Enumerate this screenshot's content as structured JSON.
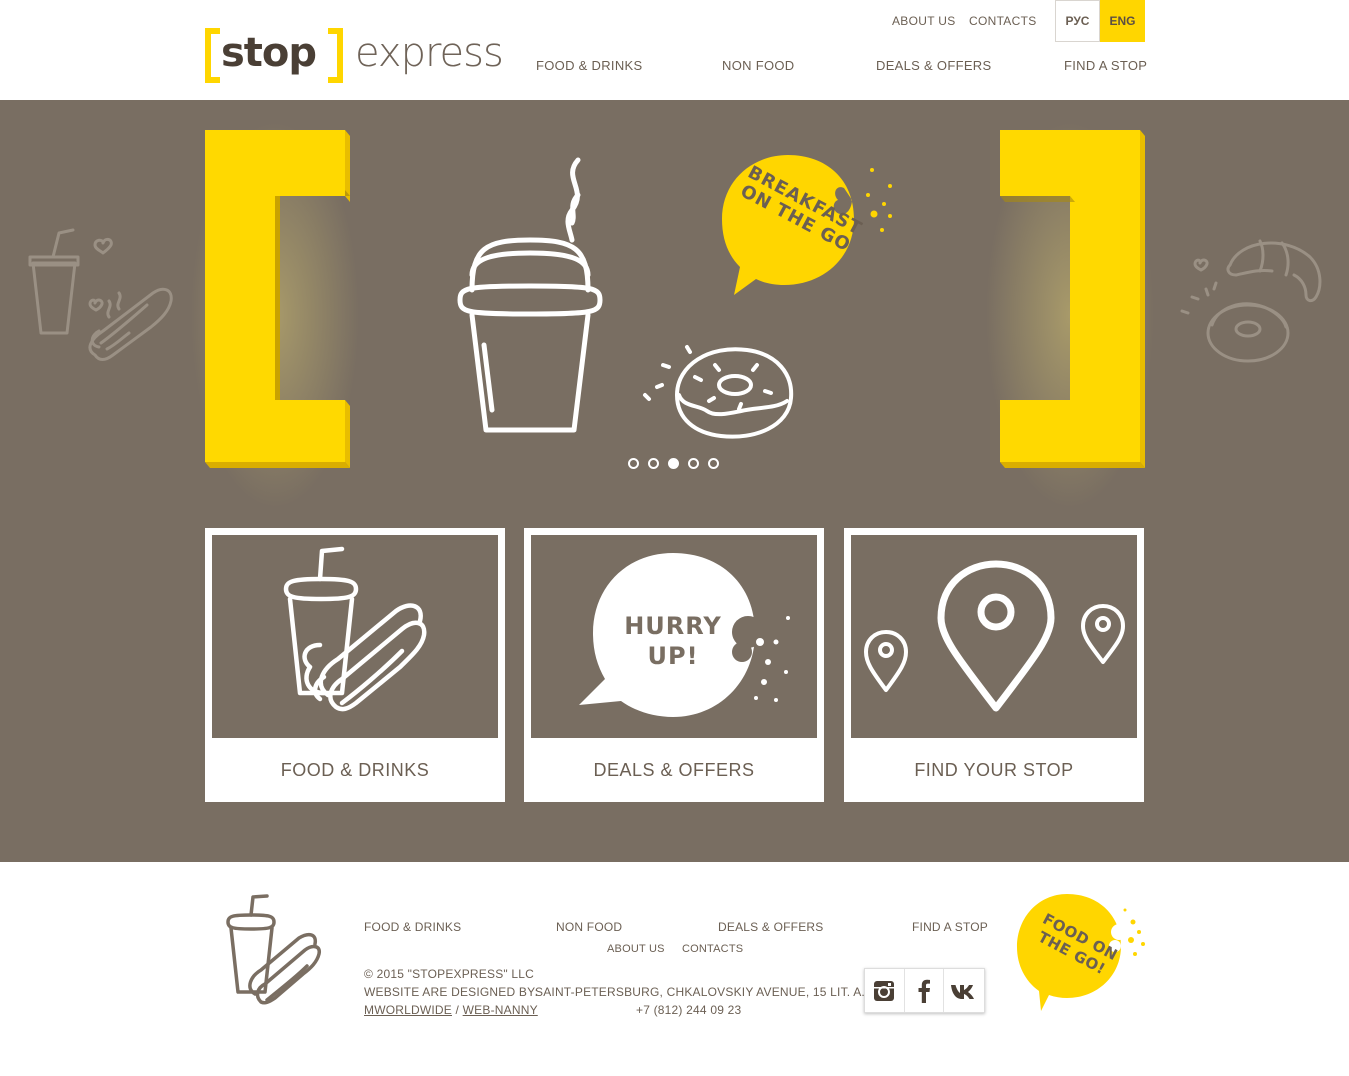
{
  "brand": {
    "stop": "stop",
    "express": "express",
    "yellow": "#ffd600",
    "brown": "#796e62"
  },
  "top_links": [
    "ABOUT US",
    "CONTACTS"
  ],
  "lang": {
    "ru": "РУС",
    "en": "ENG",
    "active": "ENG"
  },
  "nav": [
    "FOOD & DRINKS",
    "NON FOOD",
    "DEALS & OFFERS",
    "FIND A STOP"
  ],
  "hero": {
    "bubble_line1": "BREAKFAST",
    "bubble_line2": "ON THE GO",
    "slides_total": 5,
    "slide_active": 3
  },
  "cards": [
    {
      "label": "FOOD & DRINKS",
      "icon": "drink-hotdog-icon"
    },
    {
      "label": "DEALS & OFFERS",
      "icon": "hurry-up-bubble-icon",
      "bubble_line1": "HURRY",
      "bubble_line2": "UP!"
    },
    {
      "label": "FIND YOUR STOP",
      "icon": "map-pin-icon"
    }
  ],
  "footer": {
    "nav": [
      "FOOD & DRINKS",
      "NON FOOD",
      "DEALS & OFFERS",
      "FIND A STOP"
    ],
    "subnav": [
      "ABOUT US",
      "CONTACTS"
    ],
    "copyright": "© 2015 \"STOPEXPRESS\" LLC",
    "designed_by": "WEBSITE ARE DESIGNED BY:",
    "designer1": "MWORLDWIDE",
    "designer_sep": "/",
    "designer2": "WEB-NANNY",
    "address": "SAINT-PETERSBURG, CHKALOVSKIY AVENUE, 15 LIT. A.",
    "phone": "+7 (812) 244 09 23",
    "bubble_line1": "FOOD ON",
    "bubble_line2": "THE GO!",
    "social": [
      "instagram-icon",
      "facebook-icon",
      "vk-icon"
    ]
  }
}
